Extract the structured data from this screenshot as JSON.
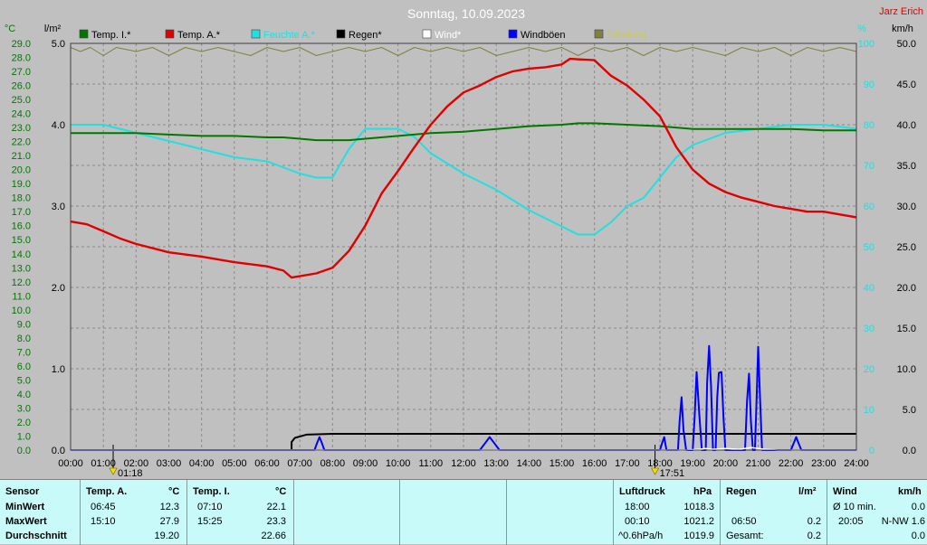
{
  "chart_data": {
    "type": "line",
    "title": "Sonntag, 10.09.2023",
    "author": "Jarz Erich",
    "axis_units": {
      "temp": "°C",
      "rain": "l/m²",
      "humidity": "%",
      "wind": "km/h"
    },
    "x": {
      "min": 0,
      "max": 24,
      "ticks": [
        "00:00",
        "01:00",
        "02:00",
        "03:00",
        "04:00",
        "05:00",
        "06:00",
        "07:00",
        "08:00",
        "09:00",
        "10:00",
        "11:00",
        "12:00",
        "13:00",
        "14:00",
        "15:00",
        "16:00",
        "17:00",
        "18:00",
        "19:00",
        "20:00",
        "21:00",
        "22:00",
        "23:00",
        "24:00"
      ]
    },
    "y_temp": {
      "min": 0.0,
      "max": 29.0,
      "ticks": [
        "0.0",
        "1.0",
        "2.0",
        "3.0",
        "4.0",
        "5.0",
        "6.0",
        "7.0",
        "8.0",
        "9.0",
        "10.0",
        "11.0",
        "12.0",
        "13.0",
        "14.0",
        "15.0",
        "16.0",
        "17.0",
        "18.0",
        "19.0",
        "20.0",
        "21.0",
        "22.0",
        "23.0",
        "24.0",
        "25.0",
        "26.0",
        "27.0",
        "28.0",
        "29.0"
      ]
    },
    "y_rain": {
      "min": 0.0,
      "max": 5.0,
      "ticks": [
        "0.0",
        "1.0",
        "2.0",
        "3.0",
        "4.0",
        "5.0"
      ]
    },
    "y_humidity": {
      "min": 0,
      "max": 100,
      "ticks": [
        "0",
        "10",
        "20",
        "30",
        "40",
        "50",
        "60",
        "70",
        "80",
        "90",
        "100"
      ]
    },
    "y_wind": {
      "min": 0.0,
      "max": 50.0,
      "ticks": [
        "0.0",
        "5.0",
        "10.0",
        "15.0",
        "20.0",
        "25.0",
        "30.0",
        "35.0",
        "40.0",
        "45.0",
        "50.0"
      ]
    },
    "grid": true,
    "legend_position": "top",
    "sun_markers": [
      {
        "x": 1.3,
        "label": "01:18"
      },
      {
        "x": 17.85,
        "label": "17:51"
      }
    ],
    "series": [
      {
        "name": "Temp. I.*",
        "axis": "temp",
        "color": "#007800",
        "points": [
          [
            0,
            22.6
          ],
          [
            1,
            22.6
          ],
          [
            2,
            22.6
          ],
          [
            3,
            22.5
          ],
          [
            4,
            22.4
          ],
          [
            5,
            22.4
          ],
          [
            6,
            22.3
          ],
          [
            6.5,
            22.3
          ],
          [
            7,
            22.2
          ],
          [
            7.5,
            22.1
          ],
          [
            8,
            22.1
          ],
          [
            8.5,
            22.1
          ],
          [
            9,
            22.2
          ],
          [
            10,
            22.4
          ],
          [
            11,
            22.6
          ],
          [
            12,
            22.7
          ],
          [
            13,
            22.9
          ],
          [
            14,
            23.1
          ],
          [
            15,
            23.2
          ],
          [
            15.5,
            23.3
          ],
          [
            16,
            23.3
          ],
          [
            17,
            23.2
          ],
          [
            18,
            23.1
          ],
          [
            19,
            22.9
          ],
          [
            20,
            22.9
          ],
          [
            21,
            22.9
          ],
          [
            22,
            22.9
          ],
          [
            23,
            22.8
          ],
          [
            24,
            22.8
          ]
        ]
      },
      {
        "name": "Temp. A.*",
        "axis": "temp",
        "color": "#e00000",
        "points": [
          [
            0,
            16.3
          ],
          [
            0.5,
            16.1
          ],
          [
            1,
            15.6
          ],
          [
            1.5,
            15.1
          ],
          [
            2,
            14.7
          ],
          [
            3,
            14.1
          ],
          [
            4,
            13.8
          ],
          [
            5,
            13.4
          ],
          [
            6,
            13.1
          ],
          [
            6.5,
            12.8
          ],
          [
            6.75,
            12.3
          ],
          [
            7,
            12.4
          ],
          [
            7.5,
            12.6
          ],
          [
            8,
            13.0
          ],
          [
            8.5,
            14.2
          ],
          [
            9,
            16.0
          ],
          [
            9.5,
            18.3
          ],
          [
            10,
            19.9
          ],
          [
            10.5,
            21.6
          ],
          [
            11,
            23.2
          ],
          [
            11.5,
            24.5
          ],
          [
            12,
            25.5
          ],
          [
            12.5,
            26.0
          ],
          [
            13,
            26.6
          ],
          [
            13.5,
            27.0
          ],
          [
            14,
            27.2
          ],
          [
            14.5,
            27.3
          ],
          [
            15,
            27.5
          ],
          [
            15.25,
            27.9
          ],
          [
            16,
            27.8
          ],
          [
            16.5,
            26.7
          ],
          [
            17,
            26.0
          ],
          [
            17.5,
            25.0
          ],
          [
            18,
            23.8
          ],
          [
            18.5,
            21.6
          ],
          [
            19,
            20.0
          ],
          [
            19.5,
            19.0
          ],
          [
            20,
            18.4
          ],
          [
            20.5,
            18.0
          ],
          [
            21,
            17.7
          ],
          [
            21.5,
            17.4
          ],
          [
            22,
            17.2
          ],
          [
            22.5,
            17.0
          ],
          [
            23,
            17.0
          ],
          [
            24,
            16.6
          ]
        ]
      },
      {
        "name": "Feuchte A.*",
        "axis": "humidity",
        "color": "#20e0e0",
        "points": [
          [
            0,
            80
          ],
          [
            1,
            80
          ],
          [
            2,
            78
          ],
          [
            3,
            76
          ],
          [
            4,
            74
          ],
          [
            5,
            72
          ],
          [
            6,
            71
          ],
          [
            7,
            68
          ],
          [
            7.5,
            67
          ],
          [
            8,
            67
          ],
          [
            8.5,
            74
          ],
          [
            9,
            79
          ],
          [
            10,
            79
          ],
          [
            10.5,
            77
          ],
          [
            11,
            73
          ],
          [
            12,
            68
          ],
          [
            13,
            64
          ],
          [
            14,
            59
          ],
          [
            15,
            55
          ],
          [
            15.5,
            53
          ],
          [
            16,
            53
          ],
          [
            16.5,
            56
          ],
          [
            17,
            60
          ],
          [
            17.5,
            62
          ],
          [
            18,
            67
          ],
          [
            18.5,
            72
          ],
          [
            19,
            75
          ],
          [
            20,
            78
          ],
          [
            21,
            79
          ],
          [
            22,
            80
          ],
          [
            23,
            80
          ],
          [
            24,
            79
          ]
        ]
      },
      {
        "name": "Regen*",
        "axis": "rain",
        "color": "#000000",
        "points": [
          [
            0,
            0
          ],
          [
            6.75,
            0
          ],
          [
            6.75,
            0.1
          ],
          [
            6.85,
            0.15
          ],
          [
            7.2,
            0.19
          ],
          [
            8,
            0.2
          ],
          [
            24,
            0.2
          ]
        ]
      },
      {
        "name": "Wind*",
        "axis": "wind",
        "color": "#ffffff",
        "points": [
          [
            0,
            0
          ],
          [
            18.8,
            0
          ],
          [
            19.2,
            0.1
          ],
          [
            19.4,
            0.2
          ],
          [
            19.6,
            0.1
          ],
          [
            20,
            0.2
          ],
          [
            20.4,
            0.1
          ],
          [
            20.8,
            0.3
          ],
          [
            21.2,
            0.1
          ],
          [
            21.6,
            0
          ],
          [
            24,
            0
          ]
        ]
      },
      {
        "name": "Windböen",
        "axis": "wind",
        "color": "#0000ff",
        "points": [
          [
            0,
            0
          ],
          [
            7.45,
            0
          ],
          [
            7.52,
            0.8
          ],
          [
            7.6,
            1.6
          ],
          [
            7.68,
            0.8
          ],
          [
            7.75,
            0
          ],
          [
            12.5,
            0
          ],
          [
            12.65,
            0.8
          ],
          [
            12.8,
            1.6
          ],
          [
            12.95,
            0.8
          ],
          [
            13.1,
            0
          ],
          [
            18.0,
            0
          ],
          [
            18.06,
            0.8
          ],
          [
            18.13,
            1.6
          ],
          [
            18.2,
            0
          ],
          [
            18.55,
            0
          ],
          [
            18.6,
            3.5
          ],
          [
            18.66,
            6.5
          ],
          [
            18.72,
            2.5
          ],
          [
            18.8,
            0
          ],
          [
            19.0,
            0
          ],
          [
            19.06,
            4.0
          ],
          [
            19.12,
            9.6
          ],
          [
            19.2,
            4.5
          ],
          [
            19.28,
            0
          ],
          [
            19.4,
            0
          ],
          [
            19.44,
            8.2
          ],
          [
            19.5,
            12.8
          ],
          [
            19.56,
            8.0
          ],
          [
            19.62,
            0
          ],
          [
            19.7,
            0
          ],
          [
            19.75,
            6.5
          ],
          [
            19.8,
            9.5
          ],
          [
            19.88,
            9.6
          ],
          [
            19.94,
            4.0
          ],
          [
            20.0,
            0
          ],
          [
            20.6,
            0
          ],
          [
            20.66,
            6.0
          ],
          [
            20.72,
            9.4
          ],
          [
            20.78,
            3.5
          ],
          [
            20.84,
            0
          ],
          [
            20.9,
            0
          ],
          [
            20.95,
            6.0
          ],
          [
            21.0,
            12.7
          ],
          [
            21.06,
            6.0
          ],
          [
            21.12,
            0
          ],
          [
            22.0,
            0
          ],
          [
            22.08,
            0.8
          ],
          [
            22.16,
            1.6
          ],
          [
            22.24,
            0.8
          ],
          [
            22.32,
            0
          ],
          [
            24,
            0
          ]
        ]
      },
      {
        "name": "Erholung",
        "axis": "humidity",
        "color": "#808040",
        "points": [
          [
            0,
            99
          ],
          [
            0.3,
            98
          ],
          [
            0.6,
            99
          ],
          [
            1,
            97
          ],
          [
            1.4,
            99
          ],
          [
            2,
            98
          ],
          [
            2.5,
            99
          ],
          [
            3,
            97
          ],
          [
            3.5,
            99
          ],
          [
            4,
            98
          ],
          [
            4.5,
            99
          ],
          [
            5,
            98
          ],
          [
            5.5,
            97
          ],
          [
            6,
            99
          ],
          [
            6.5,
            98
          ],
          [
            7,
            99
          ],
          [
            7.5,
            97
          ],
          [
            8,
            98
          ],
          [
            8.5,
            99
          ],
          [
            9,
            98
          ],
          [
            9.5,
            99
          ],
          [
            10,
            97
          ],
          [
            10.5,
            99
          ],
          [
            11,
            98
          ],
          [
            11.5,
            99
          ],
          [
            12,
            98
          ],
          [
            12.5,
            99
          ],
          [
            13,
            97
          ],
          [
            13.5,
            98
          ],
          [
            14,
            99
          ],
          [
            14.5,
            98
          ],
          [
            15,
            99
          ],
          [
            15.5,
            97
          ],
          [
            16,
            99
          ],
          [
            16.5,
            98
          ],
          [
            17,
            99
          ],
          [
            17.5,
            97
          ],
          [
            18,
            99
          ],
          [
            18.5,
            98
          ],
          [
            19,
            99
          ],
          [
            19.5,
            98
          ],
          [
            20,
            97
          ],
          [
            20.5,
            99
          ],
          [
            21,
            98
          ],
          [
            21.5,
            99
          ],
          [
            22,
            97
          ],
          [
            22.5,
            99
          ],
          [
            23,
            98
          ],
          [
            23.5,
            99
          ],
          [
            24,
            98
          ]
        ]
      }
    ]
  },
  "table": {
    "sensor_header": "Sensor",
    "row_labels": [
      "MinWert",
      "MaxWert",
      "Durchschnitt"
    ],
    "temp_a": {
      "header": "Temp. A.",
      "unit": "°C",
      "min_time": "06:45",
      "min": "12.3",
      "max_time": "15:10",
      "max": "27.9",
      "avg": "19.20"
    },
    "temp_i": {
      "header": "Temp. I.",
      "unit": "°C",
      "min_time": "07:10",
      "min": "22.1",
      "max_time": "15:25",
      "max": "23.3",
      "avg": "22.66"
    },
    "pressure": {
      "header": "Luftdruck",
      "unit": "hPa",
      "r1_label": "18:00",
      "r1_value": "1018.3",
      "r2_label": "00:10",
      "r2_value": "1021.2",
      "r3_label": "^0.6hPa/h",
      "r3_value": "1019.9"
    },
    "rain": {
      "header": "Regen",
      "unit": "l/m²",
      "r2_label": "06:50",
      "r2_value": "0.2",
      "r3_label": "Gesamt:",
      "r3_value": "0.2"
    },
    "wind": {
      "header": "Wind",
      "unit": "km/h",
      "r1_label": "Ø 10 min.",
      "r1_value": "0.0",
      "r2_label": "20:05",
      "r2_value": "N-NW 1.6",
      "r3_value": "0.0"
    }
  }
}
